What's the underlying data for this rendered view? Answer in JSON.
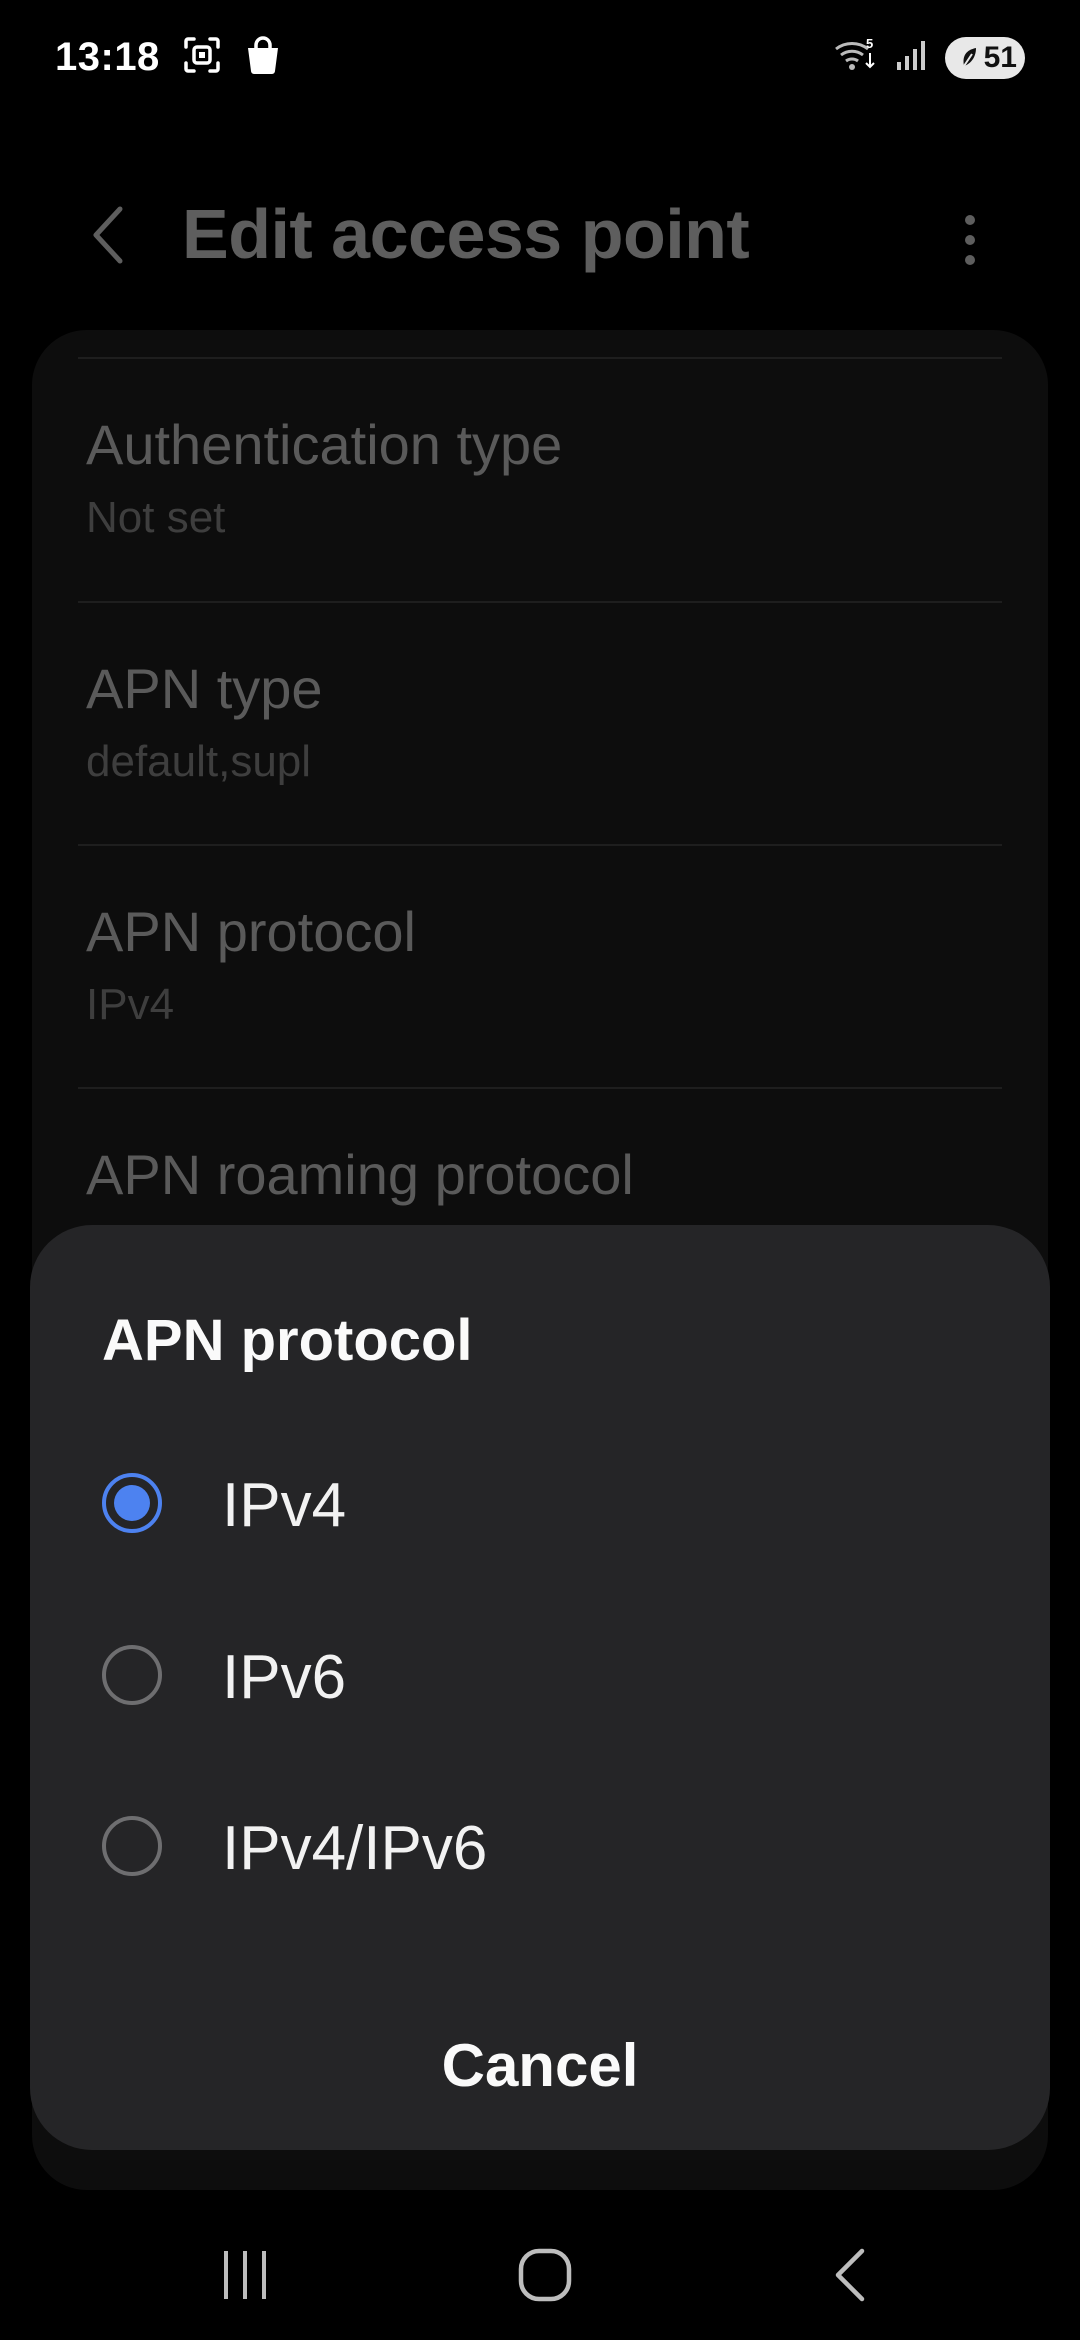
{
  "status_bar": {
    "time": "13:18",
    "left_icons": [
      "screenshot-icon",
      "shopping-bag-icon"
    ],
    "right_icons": [
      "wifi-5-icon",
      "signal-icon"
    ],
    "battery": "51"
  },
  "header": {
    "title": "Edit access point",
    "back_icon": "chevron-left-icon",
    "more_icon": "more-vert-icon"
  },
  "settings": [
    {
      "title": "Authentication type",
      "value": "Not set"
    },
    {
      "title": "APN type",
      "value": "default,supl"
    },
    {
      "title": "APN protocol",
      "value": "IPv4"
    },
    {
      "title": "APN roaming protocol",
      "value": ""
    }
  ],
  "dialog": {
    "title": "APN protocol",
    "options": [
      {
        "label": "IPv4",
        "selected": true
      },
      {
        "label": "IPv6",
        "selected": false
      },
      {
        "label": "IPv4/IPv6",
        "selected": false
      }
    ],
    "cancel_label": "Cancel"
  },
  "nav_bar": {
    "recents_icon": "recents-icon",
    "home_icon": "home-icon",
    "back_icon": "back-icon"
  },
  "colors": {
    "accent": "#4d82f0",
    "dialog_bg": "#252527",
    "background": "#000000"
  }
}
